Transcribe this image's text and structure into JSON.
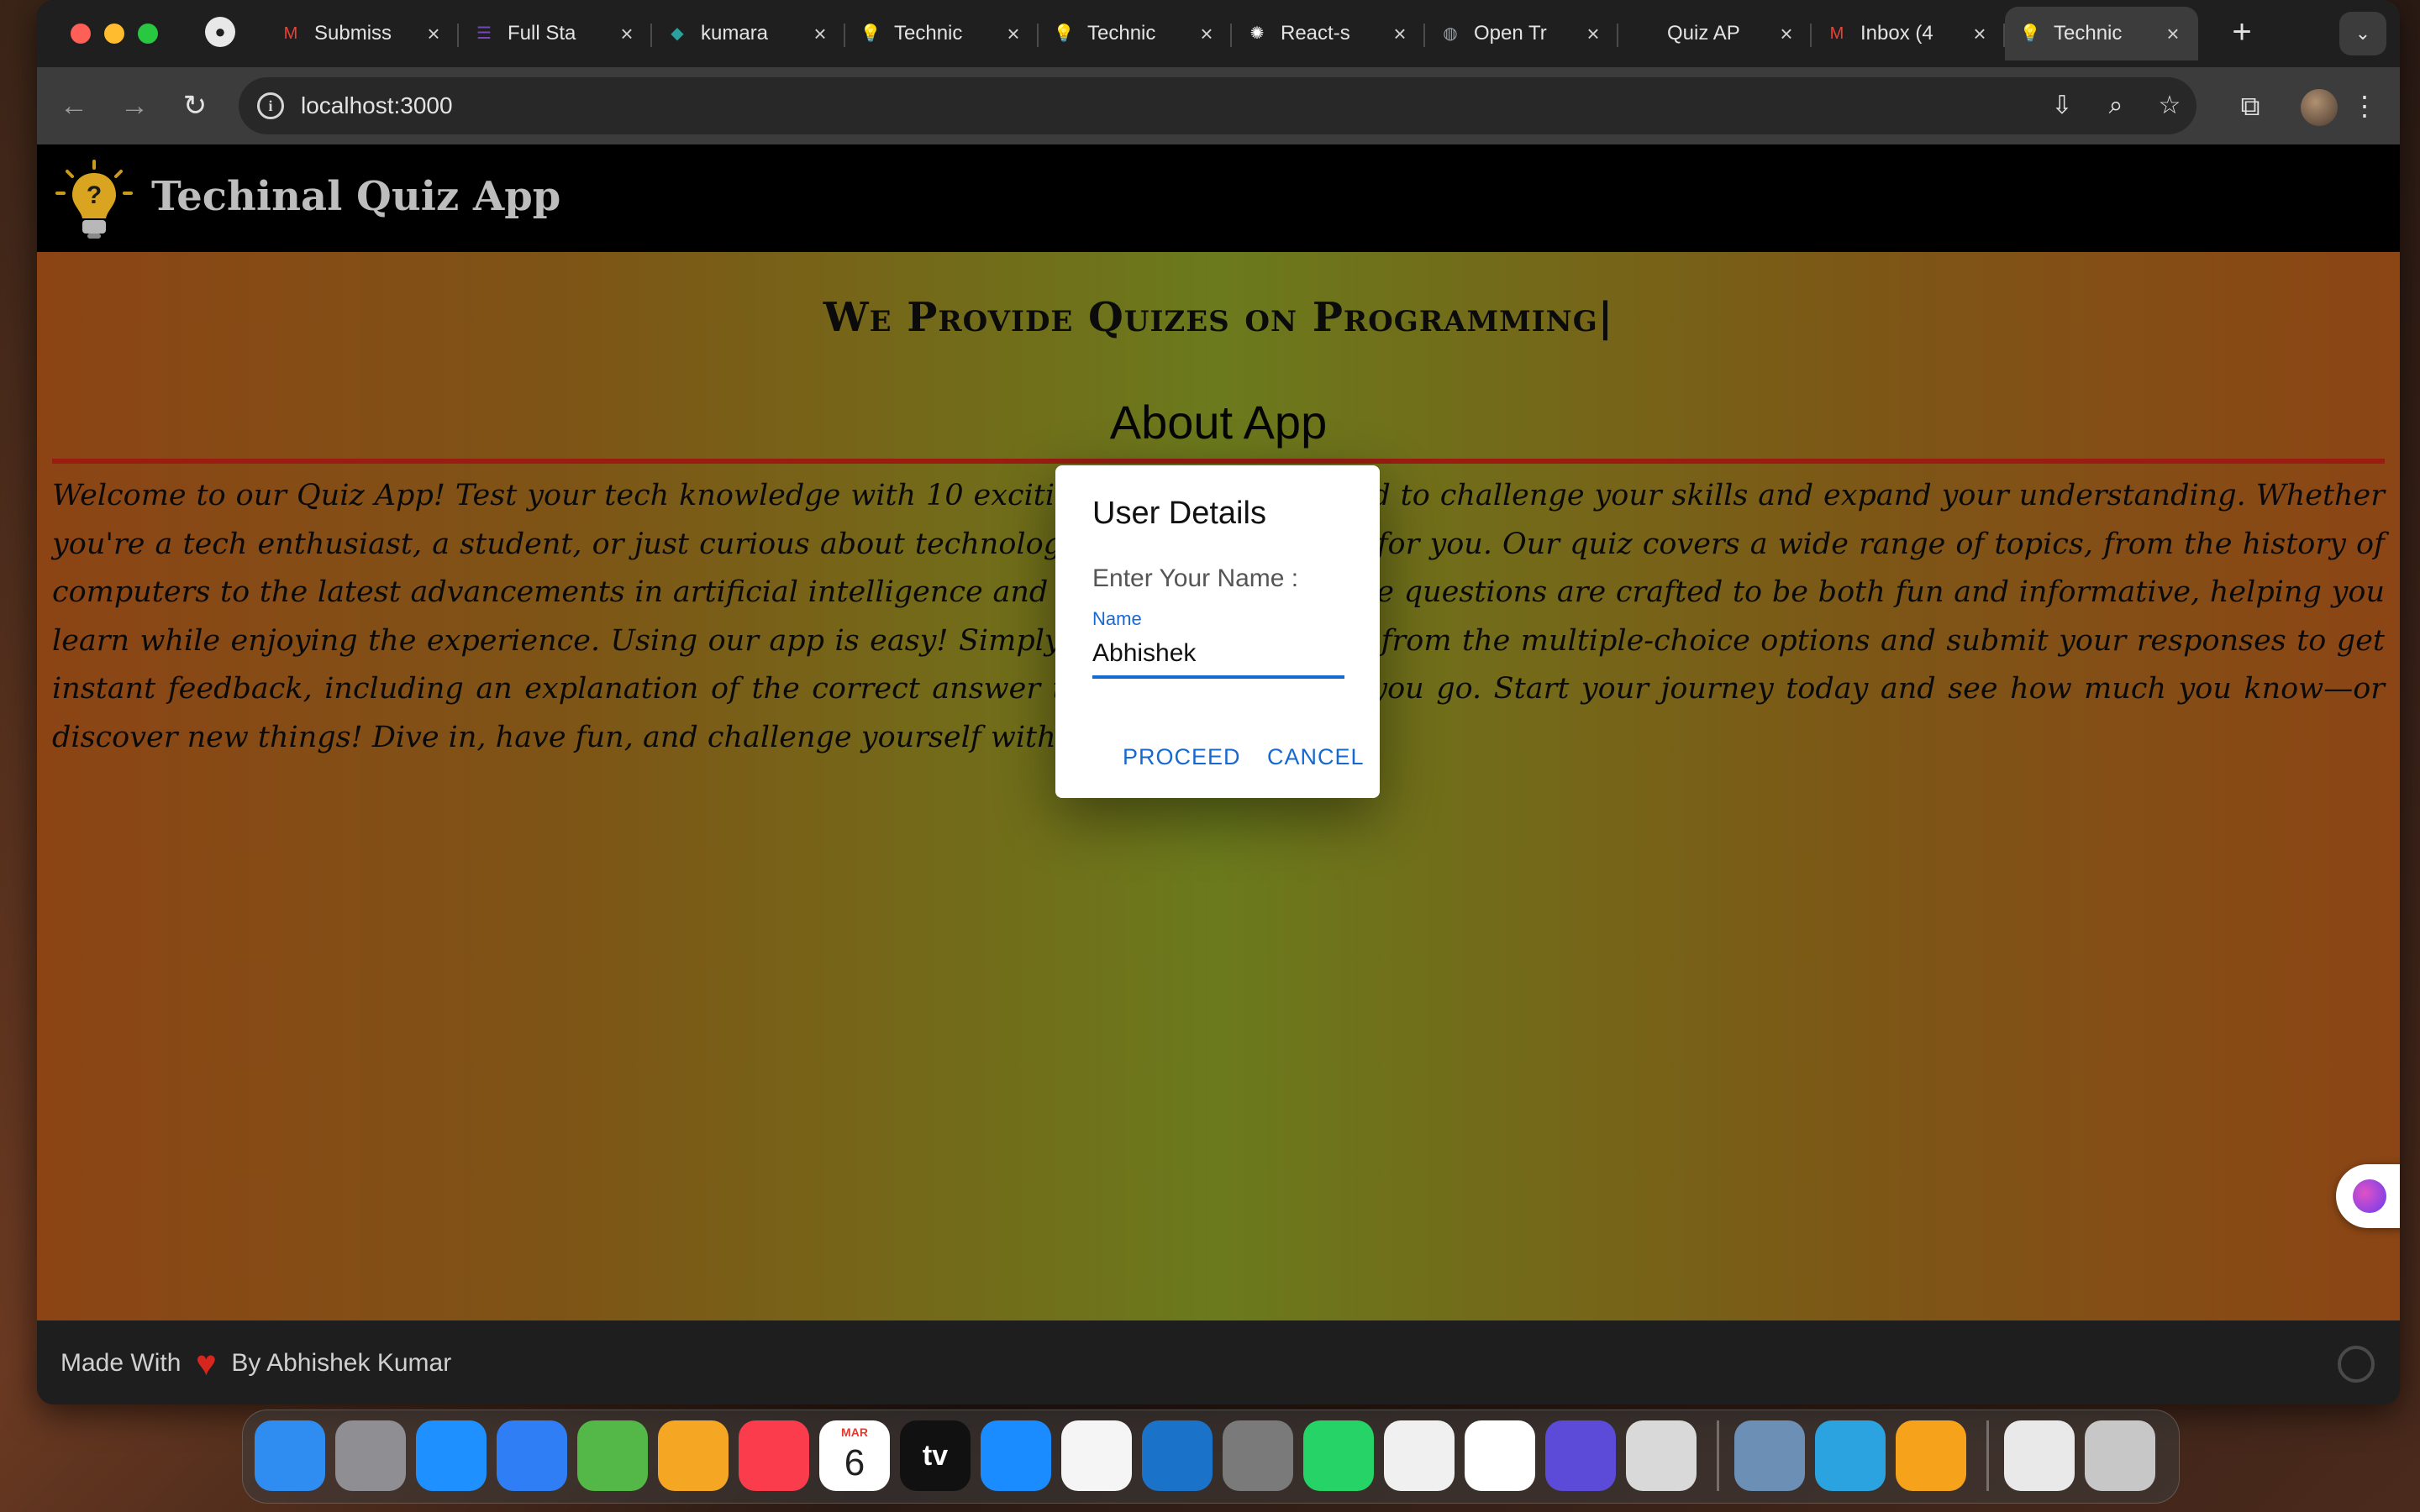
{
  "browser": {
    "tabs": [
      {
        "title": "Submiss",
        "icon": "gmail-icon",
        "color": "#ea4335",
        "glyph": "M"
      },
      {
        "title": "Full Sta",
        "icon": "forms-icon",
        "color": "#7248b9",
        "glyph": "☰"
      },
      {
        "title": "kumara",
        "icon": "diamond-icon",
        "color": "#2aa19e",
        "glyph": "◆"
      },
      {
        "title": "Technic",
        "icon": "bulb-icon",
        "color": "#d9a520",
        "glyph": "💡"
      },
      {
        "title": "Technic",
        "icon": "bulb-icon",
        "color": "#d9a520",
        "glyph": "💡"
      },
      {
        "title": "React-s",
        "icon": "openai-icon",
        "color": "#ffffff",
        "glyph": "✺"
      },
      {
        "title": "Open Tr",
        "icon": "globe-icon",
        "color": "#9aa0a6",
        "glyph": "◍"
      },
      {
        "title": "Quiz AP",
        "icon": "blank-icon",
        "color": "#1f1f1f",
        "glyph": ""
      },
      {
        "title": "Inbox (4",
        "icon": "gmail-icon",
        "color": "#ea4335",
        "glyph": "M"
      },
      {
        "title": "Technic",
        "icon": "bulb-icon",
        "color": "#d9a520",
        "glyph": "💡",
        "active": true
      }
    ],
    "url": "localhost:3000"
  },
  "app": {
    "title": "Techinal Quiz App",
    "tagline": "We Provide Quizes on Programming|",
    "about_heading": "About App",
    "about_text": "Welcome to our Quiz App! Test your tech knowledge with 10 exciting questions designed to challenge your skills and expand your understanding. Whether you're a tech enthusiast, a student, or just curious about technology, this app is perfect for you. Our quiz covers a wide range of topics, from the history of computers to the latest advancements in artificial intelligence and machine learning. The questions are crafted to be both fun and informative, helping you learn while enjoying the experience. Using our app is easy! Simply select your answers from the multiple-choice options and submit your responses to get instant feedback, including an explanation of the correct answer to help you learn as you go. Start your journey today and see how much you know—or discover new things! Dive in, have fun, and challenge yourself with our tech quiz.",
    "footer_prefix": "Made With",
    "footer_suffix": "By Abhishek Kumar"
  },
  "dialog": {
    "title": "User Details",
    "prompt": "Enter Your Name :",
    "field_label": "Name",
    "field_value": "Abhishek",
    "proceed": "PROCEED",
    "cancel": "CANCEL"
  },
  "dock": {
    "calendar_month": "MAR",
    "calendar_day": "6",
    "tv_label": "tv",
    "items": [
      {
        "name": "finder-icon",
        "color": "#2f8cf0"
      },
      {
        "name": "launchpad-icon",
        "color": "#8e8e93"
      },
      {
        "name": "safari-icon",
        "color": "#1e90ff"
      },
      {
        "name": "mail-icon",
        "color": "#2f7ef5"
      },
      {
        "name": "maps-icon",
        "color": "#54b848"
      },
      {
        "name": "photos-icon",
        "color": "#f5a623"
      },
      {
        "name": "music-icon",
        "color": "#fa3c4c"
      },
      {
        "name": "calendar-icon",
        "color": "#ffffff"
      },
      {
        "name": "apple-tv-icon",
        "color": "#111111"
      },
      {
        "name": "app-store-icon",
        "color": "#1a8cff"
      },
      {
        "name": "mongodb-compass-icon",
        "color": "#f5f5f5"
      },
      {
        "name": "vscode-icon",
        "color": "#1a73c8"
      },
      {
        "name": "system-settings-icon",
        "color": "#7a7a7a"
      },
      {
        "name": "whatsapp-icon",
        "color": "#25d366"
      },
      {
        "name": "chrome-icon",
        "color": "#f0f0f0"
      },
      {
        "name": "freeform-icon",
        "color": "#ffffff"
      },
      {
        "name": "gear-app-icon",
        "color": "#5b4bd8"
      },
      {
        "name": "simulator-icon",
        "color": "#d9d9d9"
      },
      {
        "name": "preview-icon",
        "color": "#6c8fb5"
      },
      {
        "name": "telegram-icon",
        "color": "#2aa3e0"
      },
      {
        "name": "pages-icon",
        "color": "#f7a21b"
      },
      {
        "name": "docx-file-icon",
        "color": "#e9e9e9"
      },
      {
        "name": "trash-icon",
        "color": "#c7c7c7"
      }
    ]
  }
}
